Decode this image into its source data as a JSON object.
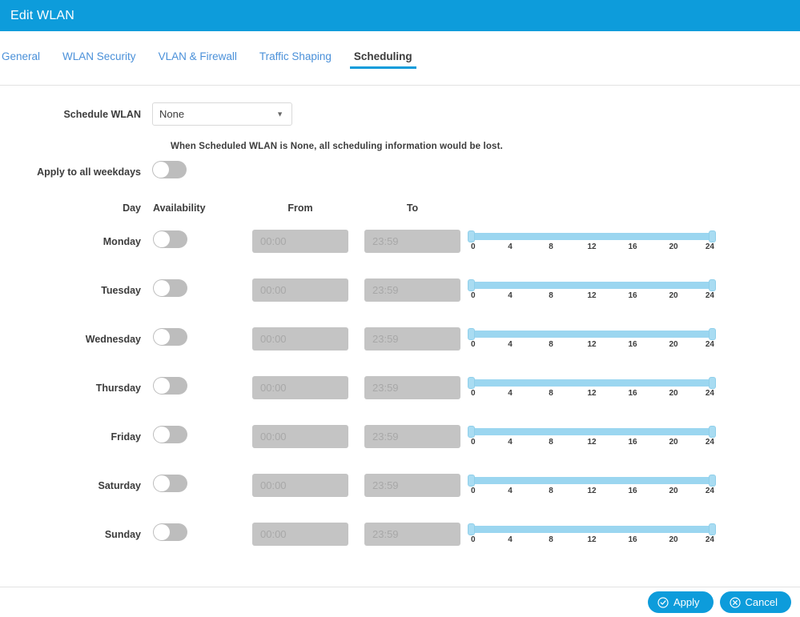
{
  "window": {
    "title": "Edit WLAN",
    "header_color": "#0d9cdb"
  },
  "tabs": [
    {
      "label": "General",
      "active": false
    },
    {
      "label": "WLAN Security",
      "active": false
    },
    {
      "label": "VLAN & Firewall",
      "active": false
    },
    {
      "label": "Traffic Shaping",
      "active": false
    },
    {
      "label": "Scheduling",
      "active": true
    }
  ],
  "form": {
    "schedule_wlan_label": "Schedule WLAN",
    "schedule_wlan_value": "None",
    "schedule_wlan_options": [
      "None"
    ],
    "caret_icon": "chevron-down-icon",
    "hint": "When Scheduled WLAN is None, all scheduling information would be lost.",
    "apply_weekdays_label": "Apply to all weekdays",
    "apply_weekdays_state": "off"
  },
  "table": {
    "headers": {
      "day": "Day",
      "availability": "Availability",
      "from": "From",
      "to": "To"
    },
    "from_placeholder": "00:00",
    "to_placeholder": "23:59",
    "slider_ticks": [
      "0",
      "4",
      "8",
      "12",
      "16",
      "20",
      "24"
    ],
    "slider_min": 0,
    "slider_max": 24,
    "slider_range_start": 0,
    "slider_range_end": 24,
    "rows": [
      {
        "day": "Monday",
        "availability": "off",
        "from": "",
        "to": ""
      },
      {
        "day": "Tuesday",
        "availability": "off",
        "from": "",
        "to": ""
      },
      {
        "day": "Wednesday",
        "availability": "off",
        "from": "",
        "to": ""
      },
      {
        "day": "Thursday",
        "availability": "off",
        "from": "",
        "to": ""
      },
      {
        "day": "Friday",
        "availability": "off",
        "from": "",
        "to": ""
      },
      {
        "day": "Saturday",
        "availability": "off",
        "from": "",
        "to": ""
      },
      {
        "day": "Sunday",
        "availability": "off",
        "from": "",
        "to": ""
      }
    ]
  },
  "footer": {
    "apply_label": "Apply",
    "apply_icon": "check-circle-icon",
    "cancel_label": "Cancel",
    "cancel_icon": "x-circle-icon"
  }
}
